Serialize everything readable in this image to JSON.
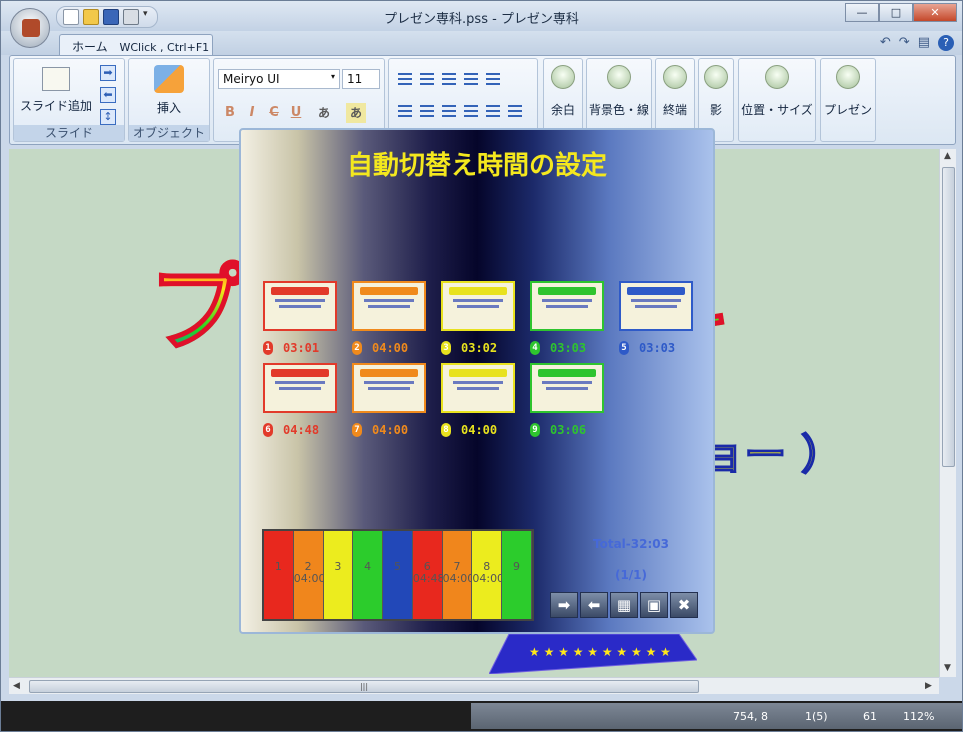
{
  "window": {
    "title": "プレゼン専科.pss - プレゼン専科",
    "minimize": "—",
    "maximize": "□",
    "close": "✕"
  },
  "qat": {
    "icons": [
      "new-icon",
      "open-icon",
      "save-icon",
      "print-icon"
    ]
  },
  "tabs": {
    "home": "ホーム",
    "shortcut": "WClick , Ctrl+F1"
  },
  "ribbon": {
    "slide_group": {
      "add_label": "スライド追加",
      "label": "スライド"
    },
    "object_group": {
      "insert_label": "挿入",
      "label": "オブジェクト"
    },
    "font": {
      "name": "Meiryo UI",
      "size": "11"
    },
    "format_buttons": [
      "B",
      "I",
      "C",
      "U",
      "あ",
      "あ"
    ],
    "margin_label": "余白",
    "bg_label": "背景色・線",
    "edge_label": "終端",
    "shadow_label": "影",
    "position_label": "位置・サイズ",
    "present_label": "プレゼン"
  },
  "slide_bg": {
    "big_text": "プレゼン専科",
    "sub_text": "（ だれでもスライドショー ）"
  },
  "dialog": {
    "title": "自動切替え時間の設定",
    "thumbs": [
      {
        "n": "1",
        "time": "03:01",
        "color": "#e23a2a"
      },
      {
        "n": "2",
        "time": "04:00",
        "color": "#f08a1c"
      },
      {
        "n": "3",
        "time": "03:02",
        "color": "#e8e21e"
      },
      {
        "n": "4",
        "time": "03:03",
        "color": "#2ec42e"
      },
      {
        "n": "5",
        "time": "03:03",
        "color": "#2e5ac8"
      },
      {
        "n": "6",
        "time": "04:48",
        "color": "#e23a2a"
      },
      {
        "n": "7",
        "time": "04:00",
        "color": "#f08a1c"
      },
      {
        "n": "8",
        "time": "04:00",
        "color": "#e8e21e"
      },
      {
        "n": "9",
        "time": "03:06",
        "color": "#2ec42e"
      }
    ],
    "bar": [
      {
        "n": "1",
        "time": "",
        "color": "#e8281e"
      },
      {
        "n": "2",
        "time": "04:00",
        "color": "#f0861c"
      },
      {
        "n": "3",
        "time": "",
        "color": "#ecec1e"
      },
      {
        "n": "4",
        "time": "",
        "color": "#2ccc2c"
      },
      {
        "n": "5",
        "time": "",
        "color": "#2248b8"
      },
      {
        "n": "6",
        "time": "04:48",
        "color": "#e8281e"
      },
      {
        "n": "7",
        "time": "04:00",
        "color": "#f0861c"
      },
      {
        "n": "8",
        "time": "04:00",
        "color": "#ecec1e"
      },
      {
        "n": "9",
        "time": "",
        "color": "#2ccc2c"
      }
    ],
    "total": "Total-32:03",
    "page": "(1/1)",
    "buttons": [
      "➡",
      "⬅",
      "▦",
      "▣",
      "✖"
    ]
  },
  "status": {
    "coords": "754, 8",
    "slide": "1(5)",
    "value": "61",
    "zoom": "112%"
  }
}
